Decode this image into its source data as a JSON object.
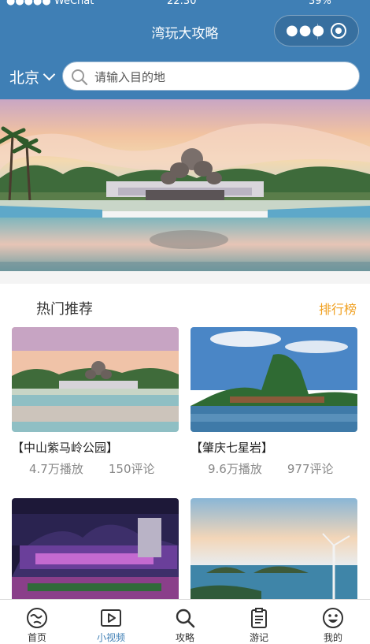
{
  "status_bar": {
    "carrier": "●●●●● WeChat",
    "time": "22:30",
    "battery": "39%"
  },
  "header": {
    "title": "湾玩大攻略",
    "city": "北京"
  },
  "search": {
    "placeholder": "请输入目的地"
  },
  "hot": {
    "title": "热门推荐",
    "rank_link": "排行榜",
    "items": [
      {
        "name": "【中山紫马岭公园】",
        "plays": "4.7万播放",
        "comments": "150评论"
      },
      {
        "name": "【肇庆七星岩】",
        "plays": "9.6万播放",
        "comments": "977评论"
      }
    ]
  },
  "tabs": [
    {
      "label": "首页",
      "icon": "home-icon"
    },
    {
      "label": "小视频",
      "icon": "video-icon",
      "active": true
    },
    {
      "label": "攻略",
      "icon": "search-icon"
    },
    {
      "label": "游记",
      "icon": "notes-icon"
    },
    {
      "label": "我的",
      "icon": "profile-icon"
    }
  ],
  "colors": {
    "primary": "#3f7fb5",
    "accent": "#f0a020"
  }
}
